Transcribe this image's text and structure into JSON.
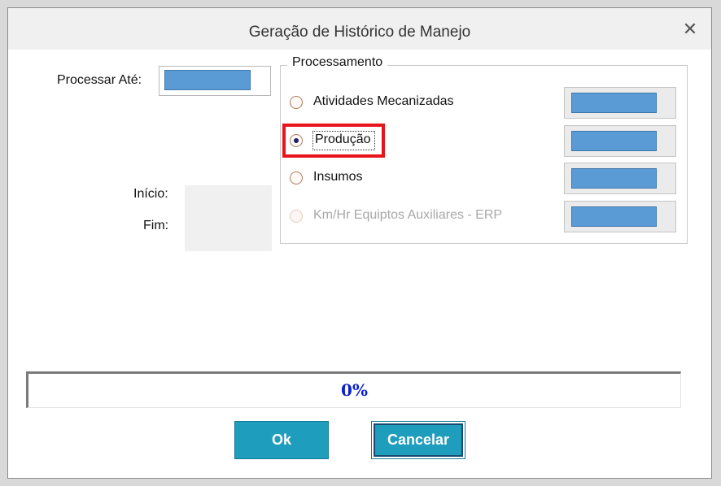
{
  "window": {
    "title": "Geração de Histórico de Manejo",
    "close_label": "✕"
  },
  "form": {
    "processar_ate_label": "Processar Até:",
    "inicio_label": "Início:",
    "fim_label": "Fim:"
  },
  "processamento": {
    "legend": "Processamento",
    "options": [
      {
        "label": "Atividades Mecanizadas",
        "selected": false,
        "enabled": true
      },
      {
        "label": "Produção",
        "selected": true,
        "enabled": true
      },
      {
        "label": "Insumos",
        "selected": false,
        "enabled": true
      },
      {
        "label": "Km/Hr  Equiptos Auxiliares - ERP",
        "selected": false,
        "enabled": false
      }
    ]
  },
  "progress": {
    "value": 0,
    "text": "0%"
  },
  "buttons": {
    "ok_label": "Ok",
    "cancel_label": "Cancelar"
  },
  "colors": {
    "field_fill": "#5b9bd5",
    "button": "#1e9dbc",
    "highlight": "#e8141c",
    "progress_text": "#0b1fcf"
  }
}
